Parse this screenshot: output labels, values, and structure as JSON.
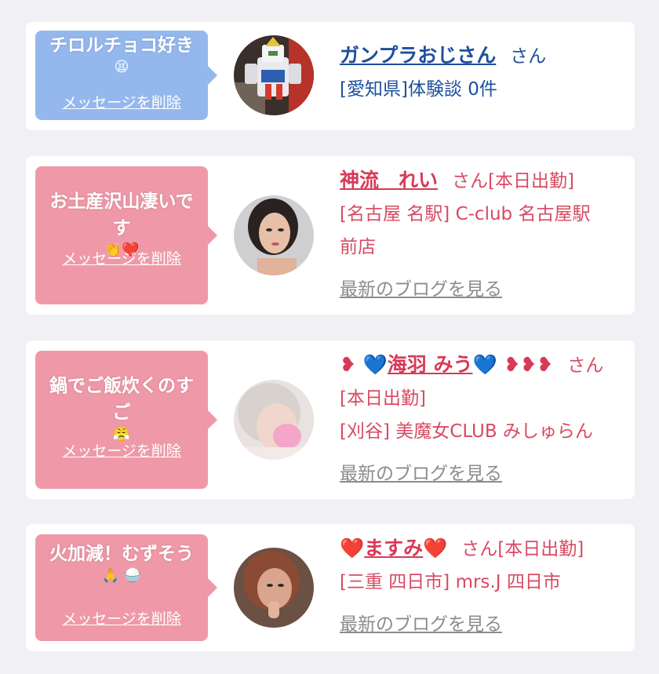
{
  "messages": [
    {
      "bubble_text": "チロルチョコ好き",
      "bubble_emoji": "😫",
      "delete_label": "メッセージを削除",
      "name": "ガンプラおじさん",
      "suffix": "さん",
      "detail": "[愛知県]体験談 0件",
      "theme": "blue"
    },
    {
      "bubble_text": "お土産沢山凄いです",
      "bubble_emoji": "👏❤️",
      "delete_label": "メッセージを削除",
      "name": "神流　れい",
      "suffix": "さん[本日出勤]",
      "detail_line1": "[名古屋 名駅] C-club 名古屋駅",
      "detail_line2": "前店",
      "blog_link": "最新のブログを見る",
      "theme": "pink"
    },
    {
      "bubble_text": "鍋でご飯炊くのすご",
      "bubble_emoji": "😤",
      "delete_label": "メッセージを削除",
      "name_prefix": "❥ 💙",
      "name": "海羽 みう",
      "name_suffix": "💙 ❥❥❥",
      "suffix": "さん",
      "detail_line1": "[本日出勤]",
      "detail_line2": "[刈谷] 美魔女CLUB みしゅらん",
      "blog_link": "最新のブログを見る",
      "theme": "pink"
    },
    {
      "bubble_text": "火加減！むずそう",
      "bubble_emoji": "🙏 🍚",
      "delete_label": "メッセージを削除",
      "name_prefix": "❤️",
      "name": "ますみ",
      "name_suffix": "❤️",
      "suffix": "さん[本日出勤]",
      "detail": "[三重 四日市] mrs.J 四日市",
      "blog_link": "最新のブログを見る",
      "theme": "pink"
    }
  ],
  "colors": {
    "background": "#f1f0f5",
    "bubble_blue": "#94b8ee",
    "bubble_pink": "#ef99a8",
    "name_blue": "#1d4f9c",
    "name_pink": "#d83a56",
    "blog_gray": "#8c8c8c"
  },
  "icons": [
    "gundam-avatar",
    "woman-avatar",
    "blonde-woman-avatar",
    "woman-selfie-avatar"
  ]
}
